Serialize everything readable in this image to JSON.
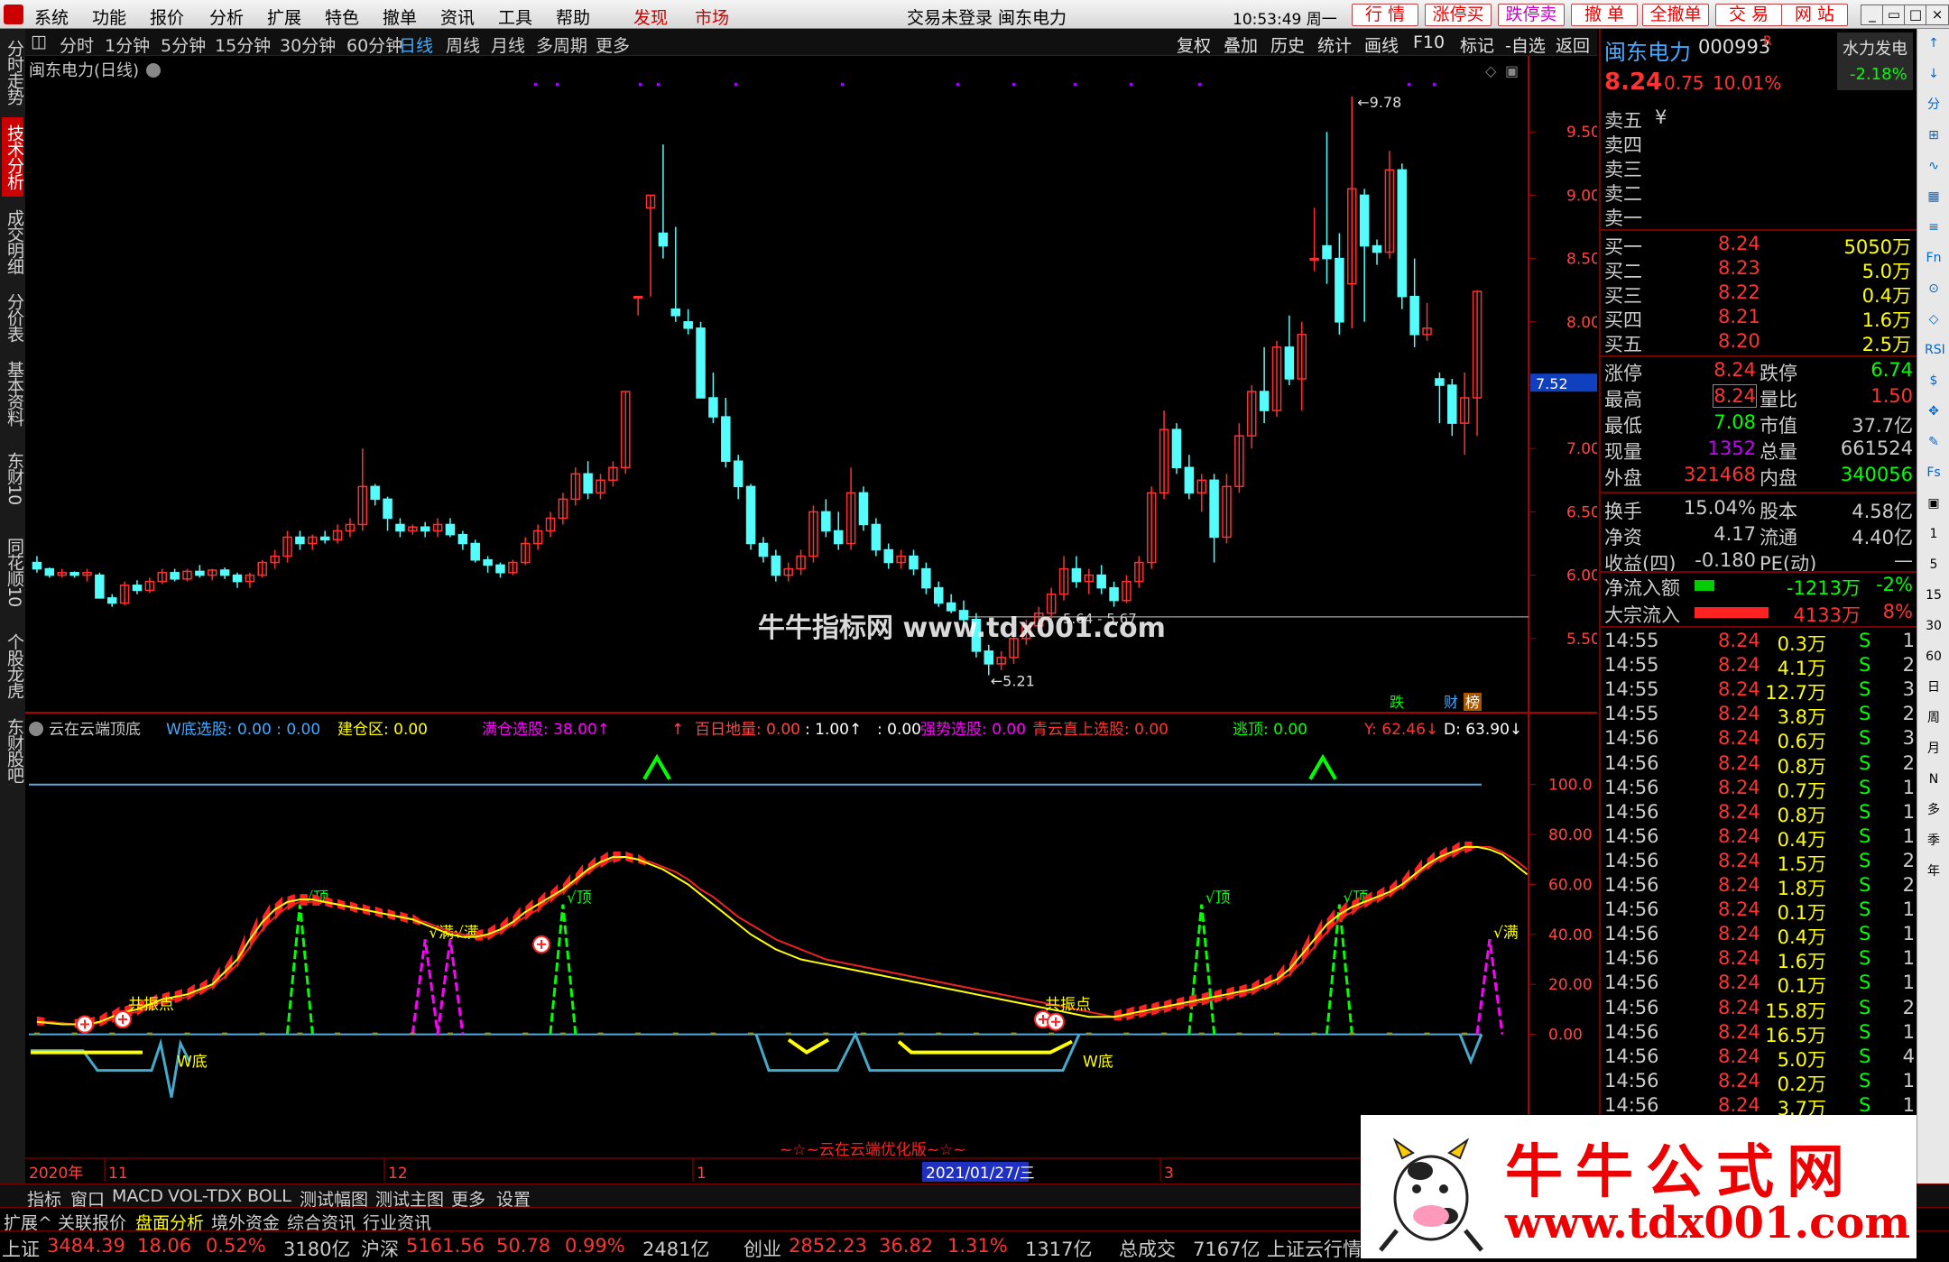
{
  "app": {
    "title": "交易未登录 闽东电力",
    "time": "10:53:49 周一"
  },
  "menu": [
    "系统",
    "功能",
    "报价",
    "分析",
    "扩展",
    "特色",
    "撤单",
    "资讯",
    "工具",
    "帮助"
  ],
  "menu_special": [
    "发现",
    "市场"
  ],
  "top_buttons": [
    "行 情",
    "涨停买",
    "跌停卖",
    "撤 单",
    "全撤单",
    "交 易",
    "网 站"
  ],
  "window_controls": [
    "_",
    "▭",
    "□",
    "×"
  ],
  "left_tabs": [
    "分时走势",
    "技术分析",
    "成交明细",
    "分价表",
    "基本资料",
    "东财10",
    "同花顺10",
    "个股龙虎",
    "东财股吧"
  ],
  "left_tab_active": 1,
  "period_tabs": [
    "分时",
    "1分钟",
    "5分钟",
    "15分钟",
    "30分钟",
    "60分钟",
    "日线",
    "周线",
    "月线",
    "多周期",
    "更多"
  ],
  "period_active": "日线",
  "right_tools": [
    "复权",
    "叠加",
    "历史",
    "统计",
    "画线",
    "F10",
    "标记",
    "-自选",
    "返回"
  ],
  "main_chart": {
    "title": "闽东电力(日线)",
    "y_ticks": [
      "9.50",
      "9.00",
      "8.50",
      "8.00",
      "7.50",
      "7.00",
      "6.50",
      "6.00",
      "5.50"
    ],
    "high_label": "9.78",
    "low_label": "5.21",
    "range_label": "5.64 - 5.67",
    "price_tag": "7.52",
    "watermark": "牛牛指标网 www.tdx001.com"
  },
  "chart_data": {
    "type": "candlestick",
    "ylim": [
      5.0,
      10.0
    ],
    "candles": [
      [
        6.1,
        6.15,
        6.02,
        6.05
      ],
      [
        6.05,
        6.06,
        5.98,
        6.0
      ],
      [
        6.0,
        6.05,
        5.98,
        6.02
      ],
      [
        6.02,
        6.03,
        5.98,
        6.0
      ],
      [
        6.0,
        6.05,
        5.95,
        6.02
      ],
      [
        6.0,
        6.02,
        5.85,
        5.82
      ],
      [
        5.82,
        5.85,
        5.75,
        5.78
      ],
      [
        5.78,
        5.95,
        5.76,
        5.92
      ],
      [
        5.92,
        5.96,
        5.85,
        5.88
      ],
      [
        5.88,
        5.98,
        5.86,
        5.95
      ],
      [
        5.95,
        6.05,
        5.93,
        6.02
      ],
      [
        6.02,
        6.05,
        5.95,
        5.97
      ],
      [
        5.97,
        6.05,
        5.95,
        6.03
      ],
      [
        6.03,
        6.08,
        5.98,
        6.0
      ],
      [
        6.0,
        6.05,
        5.96,
        6.04
      ],
      [
        6.04,
        6.06,
        5.97,
        6.0
      ],
      [
        6.0,
        6.02,
        5.9,
        5.95
      ],
      [
        5.95,
        6.02,
        5.9,
        6.0
      ],
      [
        6.0,
        6.12,
        5.98,
        6.1
      ],
      [
        6.1,
        6.2,
        6.05,
        6.15
      ],
      [
        6.15,
        6.35,
        6.1,
        6.3
      ],
      [
        6.3,
        6.35,
        6.2,
        6.25
      ],
      [
        6.25,
        6.32,
        6.2,
        6.3
      ],
      [
        6.3,
        6.35,
        6.25,
        6.28
      ],
      [
        6.28,
        6.4,
        6.25,
        6.35
      ],
      [
        6.35,
        6.45,
        6.3,
        6.4
      ],
      [
        6.4,
        7.0,
        6.35,
        6.7
      ],
      [
        6.7,
        6.72,
        6.55,
        6.6
      ],
      [
        6.6,
        6.62,
        6.35,
        6.45
      ],
      [
        6.4,
        6.45,
        6.3,
        6.35
      ],
      [
        6.35,
        6.4,
        6.32,
        6.38
      ],
      [
        6.38,
        6.42,
        6.3,
        6.35
      ],
      [
        6.35,
        6.45,
        6.3,
        6.4
      ],
      [
        6.4,
        6.45,
        6.3,
        6.32
      ],
      [
        6.32,
        6.35,
        6.2,
        6.25
      ],
      [
        6.25,
        6.28,
        6.1,
        6.12
      ],
      [
        6.12,
        6.15,
        6.02,
        6.08
      ],
      [
        6.08,
        6.1,
        5.98,
        6.02
      ],
      [
        6.02,
        6.12,
        6.0,
        6.1
      ],
      [
        6.1,
        6.3,
        6.08,
        6.25
      ],
      [
        6.25,
        6.4,
        6.2,
        6.35
      ],
      [
        6.35,
        6.5,
        6.3,
        6.45
      ],
      [
        6.45,
        6.65,
        6.4,
        6.6
      ],
      [
        6.6,
        6.85,
        6.55,
        6.8
      ],
      [
        6.8,
        6.9,
        6.6,
        6.65
      ],
      [
        6.65,
        6.8,
        6.6,
        6.75
      ],
      [
        6.75,
        6.9,
        6.7,
        6.85
      ],
      [
        6.85,
        7.45,
        6.8,
        7.45
      ],
      [
        8.2,
        8.2,
        8.05,
        8.2
      ],
      [
        8.9,
        9.0,
        8.2,
        9.0
      ],
      [
        8.7,
        9.4,
        8.5,
        8.6
      ],
      [
        8.1,
        8.75,
        8.0,
        8.05
      ],
      [
        8.0,
        8.1,
        7.9,
        7.95
      ],
      [
        7.95,
        8.0,
        7.45,
        7.4
      ],
      [
        7.4,
        7.6,
        7.2,
        7.25
      ],
      [
        7.25,
        7.4,
        6.85,
        6.9
      ],
      [
        6.9,
        6.95,
        6.6,
        6.7
      ],
      [
        6.7,
        6.72,
        6.2,
        6.25
      ],
      [
        6.25,
        6.3,
        6.1,
        6.15
      ],
      [
        6.15,
        6.2,
        5.95,
        6.0
      ],
      [
        6.0,
        6.1,
        5.95,
        6.05
      ],
      [
        6.05,
        6.2,
        6.0,
        6.15
      ],
      [
        6.15,
        6.55,
        6.1,
        6.5
      ],
      [
        6.5,
        6.6,
        6.3,
        6.35
      ],
      [
        6.35,
        6.5,
        6.2,
        6.25
      ],
      [
        6.25,
        6.85,
        6.2,
        6.65
      ],
      [
        6.65,
        6.7,
        6.35,
        6.4
      ],
      [
        6.4,
        6.45,
        6.15,
        6.2
      ],
      [
        6.2,
        6.25,
        6.05,
        6.1
      ],
      [
        6.1,
        6.2,
        6.05,
        6.15
      ],
      [
        6.15,
        6.2,
        6.0,
        6.05
      ],
      [
        6.05,
        6.1,
        5.85,
        5.9
      ],
      [
        5.9,
        5.95,
        5.75,
        5.78
      ],
      [
        5.78,
        5.85,
        5.7,
        5.72
      ],
      [
        5.72,
        5.8,
        5.6,
        5.65
      ],
      [
        5.65,
        5.7,
        5.35,
        5.4
      ],
      [
        5.4,
        5.45,
        5.21,
        5.3
      ],
      [
        5.3,
        5.4,
        5.25,
        5.35
      ],
      [
        5.35,
        5.55,
        5.3,
        5.5
      ],
      [
        5.5,
        5.65,
        5.45,
        5.6
      ],
      [
        5.6,
        5.75,
        5.55,
        5.7
      ],
      [
        5.7,
        5.9,
        5.65,
        5.85
      ],
      [
        5.85,
        6.15,
        5.8,
        6.05
      ],
      [
        6.05,
        6.15,
        5.9,
        5.95
      ],
      [
        5.95,
        6.05,
        5.85,
        6.0
      ],
      [
        6.0,
        6.08,
        5.85,
        5.9
      ],
      [
        5.9,
        5.95,
        5.75,
        5.8
      ],
      [
        5.8,
        6.0,
        5.78,
        5.95
      ],
      [
        5.95,
        6.15,
        5.9,
        6.1
      ],
      [
        6.1,
        6.7,
        6.05,
        6.65
      ],
      [
        6.65,
        7.3,
        6.6,
        7.15
      ],
      [
        7.15,
        7.2,
        6.8,
        6.85
      ],
      [
        6.85,
        6.95,
        6.6,
        6.65
      ],
      [
        6.65,
        6.8,
        6.5,
        6.75
      ],
      [
        6.75,
        6.8,
        6.1,
        6.3
      ],
      [
        6.3,
        6.8,
        6.25,
        6.7
      ],
      [
        6.7,
        7.2,
        6.65,
        7.1
      ],
      [
        7.1,
        7.5,
        7.0,
        7.45
      ],
      [
        7.45,
        7.8,
        7.2,
        7.3
      ],
      [
        7.3,
        7.85,
        7.25,
        7.8
      ],
      [
        7.8,
        8.05,
        7.5,
        7.55
      ],
      [
        7.55,
        8.0,
        7.3,
        7.9
      ],
      [
        8.5,
        8.9,
        8.4,
        8.5
      ],
      [
        8.6,
        9.5,
        8.3,
        8.5
      ],
      [
        8.5,
        8.7,
        7.9,
        8.0
      ],
      [
        8.3,
        9.78,
        7.95,
        9.05
      ],
      [
        9.0,
        9.05,
        8.0,
        8.6
      ],
      [
        8.6,
        8.65,
        8.45,
        8.55
      ],
      [
        8.55,
        9.35,
        8.5,
        9.2
      ],
      [
        9.2,
        9.25,
        8.1,
        8.2
      ],
      [
        8.2,
        8.5,
        7.8,
        7.9
      ],
      [
        7.9,
        8.15,
        7.85,
        7.95
      ],
      [
        7.55,
        7.6,
        7.2,
        7.5
      ],
      [
        7.5,
        7.55,
        7.1,
        7.2
      ],
      [
        7.2,
        7.6,
        6.95,
        7.4
      ],
      [
        7.4,
        8.25,
        7.1,
        8.24
      ]
    ],
    "sub_indicator": {
      "title": "云在云端顶底",
      "ylim": [
        -20,
        110
      ],
      "y_ticks": [
        "100.0",
        "80.00",
        "60.00",
        "40.00",
        "20.00",
        "0.00"
      ],
      "line_k": [
        5,
        4.5,
        4,
        4,
        4,
        5,
        7,
        9,
        10,
        12,
        14,
        15,
        16,
        18,
        20,
        25,
        30,
        38,
        45,
        50,
        53,
        54,
        54,
        53,
        52,
        51,
        50,
        49,
        48,
        47,
        46,
        44,
        42,
        40,
        39,
        39,
        40,
        42,
        45,
        49,
        52,
        55,
        58,
        62,
        66,
        69,
        71,
        71,
        70,
        68,
        66,
        63,
        60,
        56,
        52,
        48,
        44,
        40,
        37,
        34,
        32,
        30,
        29,
        28,
        27,
        26,
        25,
        24,
        23,
        22,
        21,
        20,
        19,
        18,
        17,
        16,
        15,
        14,
        13,
        12,
        11,
        10,
        9,
        8,
        7,
        7,
        7,
        8,
        9,
        10,
        11,
        12,
        13,
        14,
        15,
        16,
        17,
        18,
        20,
        22,
        26,
        32,
        38,
        44,
        48,
        51,
        53,
        55,
        57,
        60,
        64,
        68,
        71,
        73,
        75,
        75,
        74,
        72,
        68,
        64
      ],
      "line_d": [
        5,
        5,
        4.5,
        4,
        4,
        4.5,
        6,
        8,
        9,
        11,
        13,
        14,
        15,
        17,
        19,
        23,
        28,
        35,
        42,
        47,
        51,
        53,
        53,
        53,
        52,
        51,
        50,
        49,
        48,
        47,
        46,
        45,
        43,
        41,
        40,
        39,
        39,
        41,
        44,
        47,
        50,
        54,
        57,
        61,
        65,
        68,
        70,
        71,
        70,
        69,
        67,
        65,
        62,
        58,
        55,
        51,
        47,
        44,
        41,
        38,
        36,
        34,
        32,
        30,
        29,
        28,
        27,
        26,
        25,
        24,
        23,
        22,
        21,
        20,
        19,
        18,
        17,
        16,
        15,
        14,
        13,
        12,
        11,
        10,
        9,
        8,
        7,
        7,
        8,
        9,
        10,
        11,
        12,
        13,
        14,
        15,
        16,
        17,
        19,
        21,
        24,
        29,
        35,
        41,
        46,
        49,
        52,
        54,
        56,
        59,
        63,
        67,
        70,
        72,
        74,
        75,
        75,
        73,
        70,
        66
      ],
      "spikes": [
        {
          "i": 21,
          "h": 52,
          "c": "#0f0"
        },
        {
          "i": 31,
          "h": 38,
          "c": "#f0f"
        },
        {
          "i": 33,
          "h": 38,
          "c": "#f0f"
        },
        {
          "i": 42,
          "h": 52,
          "c": "#0f0"
        },
        {
          "i": 93,
          "h": 52,
          "c": "#0f0"
        },
        {
          "i": 104,
          "h": 52,
          "c": "#0f0"
        },
        {
          "i": 116,
          "h": 38,
          "c": "#f0f"
        }
      ]
    }
  },
  "sub_chart": {
    "header": {
      "name": "云在云端顶底",
      "w_bottom": "W底选股: 0.00 : 0.00",
      "build_zone": "建仓区: 0.00",
      "full_pick": "满仓选股: 38.00↑",
      "hundred_day": "百日地量: 0.00",
      "ratio": ": 1.00↑",
      "ratio2": ": 0.00",
      "strong": "强势选股: 0.00",
      "qingyun": "青云直上选股: 0.00",
      "escape": "逃顶: 0.00",
      "y_val": "Y: 62.46↓",
      "d_val": "D: 63.90↓"
    },
    "labels": {
      "top": "√顶",
      "full": "√满",
      "w_bottom": "W底",
      "resonance": "共振点",
      "footer": "~☆~云在云端优化版~☆~",
      "die": "跌",
      "cai": "财",
      "bang": "榜"
    }
  },
  "x_axis": {
    "labels": [
      "2020年",
      "11",
      "12",
      "1",
      "2021/01/27/三",
      "3"
    ]
  },
  "bottom_tabs": [
    "指标",
    "窗口",
    "MACD",
    "VOL-TDX",
    "BOLL",
    "测试幅图",
    "测试主图",
    "更多",
    "设置"
  ],
  "bottom_tabs2": [
    "扩展^",
    "关联报价",
    "盘面分析",
    "境外资金",
    "综合资讯",
    "行业资讯"
  ],
  "status": [
    {
      "n": "上证",
      "v": "3484.39",
      "c": "18.06",
      "p": "0.52%",
      "a": "3180亿"
    },
    {
      "n": "沪深",
      "v": "5161.56",
      "c": "50.78",
      "p": "0.99%",
      "a": "2481亿"
    },
    {
      "n": "创业",
      "v": "2852.23",
      "c": "36.82",
      "p": "1.31%",
      "a": "1317亿"
    }
  ],
  "status_total": {
    "label": "总成交",
    "value": "7167亿",
    "link": "上证云行情"
  },
  "quote": {
    "name": "闽东电力",
    "code": "000993",
    "r": "R",
    "price": "8.24",
    "change": "0.75",
    "pct": "10.01%",
    "sector": "水力发电",
    "sector_pct": "-2.18%",
    "sells": [
      [
        "卖五",
        "¥",
        "",
        ""
      ],
      [
        "卖四",
        "",
        "",
        ""
      ],
      [
        "卖三",
        "",
        "",
        ""
      ],
      [
        "卖二",
        "",
        "",
        ""
      ],
      [
        "卖一",
        "",
        "",
        ""
      ]
    ],
    "buys": [
      [
        "买一",
        "8.24",
        "5050万"
      ],
      [
        "买二",
        "8.23",
        "5.0万"
      ],
      [
        "买三",
        "8.22",
        "0.4万"
      ],
      [
        "买四",
        "8.21",
        "1.6万"
      ],
      [
        "买五",
        "8.20",
        "2.5万"
      ]
    ],
    "stats": [
      [
        "涨停",
        "8.24",
        "跌停",
        "6.74"
      ],
      [
        "最高",
        "8.24",
        "量比",
        "1.50"
      ],
      [
        "最低",
        "7.08",
        "市值",
        "37.7亿"
      ],
      [
        "现量",
        "1352",
        "总量",
        "661524"
      ],
      [
        "外盘",
        "321468",
        "内盘",
        "340056"
      ],
      [
        "换手",
        "15.04%",
        "股本",
        "4.58亿"
      ],
      [
        "净资",
        "4.17",
        "流通",
        "4.40亿"
      ],
      [
        "收益(四)",
        "-0.180",
        "PE(动)",
        "—"
      ]
    ],
    "flow": [
      [
        "净流入额",
        "-1213万",
        "-2%"
      ],
      [
        "大宗流入",
        "4133万",
        "8%"
      ]
    ],
    "ticks": [
      [
        "14:55",
        "8.24",
        "0.3万",
        "S",
        "1"
      ],
      [
        "14:55",
        "8.24",
        "4.1万",
        "S",
        "2"
      ],
      [
        "14:55",
        "8.24",
        "12.7万",
        "S",
        "3"
      ],
      [
        "14:55",
        "8.24",
        "3.8万",
        "S",
        "2"
      ],
      [
        "14:56",
        "8.24",
        "0.6万",
        "S",
        "3"
      ],
      [
        "14:56",
        "8.24",
        "0.8万",
        "S",
        "2"
      ],
      [
        "14:56",
        "8.24",
        "0.7万",
        "S",
        "1"
      ],
      [
        "14:56",
        "8.24",
        "0.8万",
        "S",
        "1"
      ],
      [
        "14:56",
        "8.24",
        "0.4万",
        "S",
        "1"
      ],
      [
        "14:56",
        "8.24",
        "1.5万",
        "S",
        "2"
      ],
      [
        "14:56",
        "8.24",
        "1.8万",
        "S",
        "2"
      ],
      [
        "14:56",
        "8.24",
        "0.1万",
        "S",
        "1"
      ],
      [
        "14:56",
        "8.24",
        "0.4万",
        "S",
        "1"
      ],
      [
        "14:56",
        "8.24",
        "1.6万",
        "S",
        "1"
      ],
      [
        "14:56",
        "8.24",
        "0.1万",
        "S",
        "1"
      ],
      [
        "14:56",
        "8.24",
        "15.8万",
        "S",
        "2"
      ],
      [
        "14:56",
        "8.24",
        "16.5万",
        "S",
        "1"
      ],
      [
        "14:56",
        "8.24",
        "5.0万",
        "S",
        "4"
      ],
      [
        "14:56",
        "8.24",
        "0.2万",
        "S",
        "1"
      ],
      [
        "14:56",
        "8.24",
        "3.7万",
        "S",
        "1"
      ]
    ]
  },
  "right_toolbar": [
    "↑",
    "↓",
    "分",
    "⊞",
    "∿",
    "▦",
    "≡",
    "Fn",
    "⊙",
    "◇",
    "RSI",
    "$",
    "✥",
    "✎",
    "Fs",
    "▣",
    "1",
    "5",
    "15",
    "30",
    "60",
    "日",
    "周",
    "月",
    "N",
    "多",
    "季",
    "年"
  ],
  "ad": {
    "brand": "牛牛公式网",
    "url": "www.tdx001.com"
  },
  "colors": {
    "up": "#ff3030",
    "down": "#54fcfc",
    "bg": "#000000",
    "accent": "#cc0000"
  }
}
